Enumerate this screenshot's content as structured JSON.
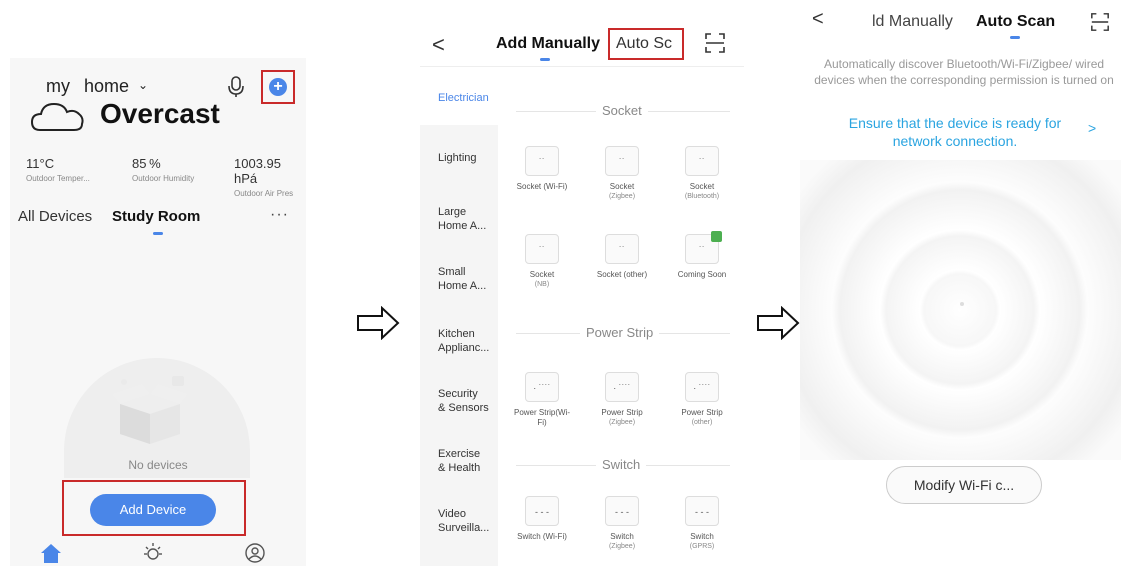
{
  "panel1": {
    "home_owner": "my",
    "home_label": "home",
    "weather": "Overcast",
    "stats": [
      {
        "value": "11°C",
        "label": "Outdoor Temper..."
      },
      {
        "value": "85 %",
        "label": "Outdoor Humidity"
      },
      {
        "value": "1003.95 hPá",
        "label": "Outdoor Air Pres"
      }
    ],
    "tabs": {
      "all": "All Devices",
      "room": "Study Room"
    },
    "more": "···",
    "empty_text": "No devices",
    "add_button": "Add Device",
    "plus": "+"
  },
  "panel2": {
    "back": "<",
    "tab_manual": "Add Manually",
    "tab_auto": "Auto Sc",
    "categories": [
      "Electrician",
      "Lighting",
      "Large\nHome A...",
      "Small\nHome A...",
      "Kitchen\nApplianc...",
      "Security\n& Sensors",
      "Exercise\n& Health",
      "Video\nSurveilla..."
    ],
    "sections": {
      "socket": "Socket",
      "power_strip": "Power Strip",
      "switch": "Switch"
    },
    "sockets": [
      {
        "label": "Socket (Wi-Fi)",
        "sub": ""
      },
      {
        "label": "Socket",
        "sub": "(Zigbee)"
      },
      {
        "label": "Socket",
        "sub": "(Bluetooth)"
      },
      {
        "label": "Socket",
        "sub": "(NB)"
      },
      {
        "label": "Socket (other)",
        "sub": ""
      },
      {
        "label": "Coming Soon",
        "sub": ""
      }
    ],
    "strips": [
      {
        "label": "Power Strip(Wi-",
        "sub": "Fi)"
      },
      {
        "label": "Power Strip",
        "sub": "(Zigbee)"
      },
      {
        "label": "Power Strip",
        "sub": "(other)"
      }
    ],
    "switches": [
      {
        "label": "Switch (Wi-Fi)",
        "sub": ""
      },
      {
        "label": "Switch",
        "sub": "(Zigbee)"
      },
      {
        "label": "Switch",
        "sub": "(GPRS)"
      }
    ],
    "socket_glyph": "˙˙",
    "strip_glyph": "· ˙˙˙˙",
    "switch_glyph": "- - -"
  },
  "panel3": {
    "back": "<",
    "tab_manual": "ld Manually",
    "tab_auto": "Auto Scan",
    "description": "Automatically discover Bluetooth/Wi-Fi/Zigbee/ wired devices when the corresponding permission is turned on",
    "ensure": "Ensure that the device is ready for network connection.",
    "ensure_chevron": ">",
    "modify_button": "Modify Wi-Fi c..."
  },
  "colors": {
    "accent": "#4a86e8",
    "highlight": "#c92a2a",
    "link": "#2aa4e0"
  }
}
